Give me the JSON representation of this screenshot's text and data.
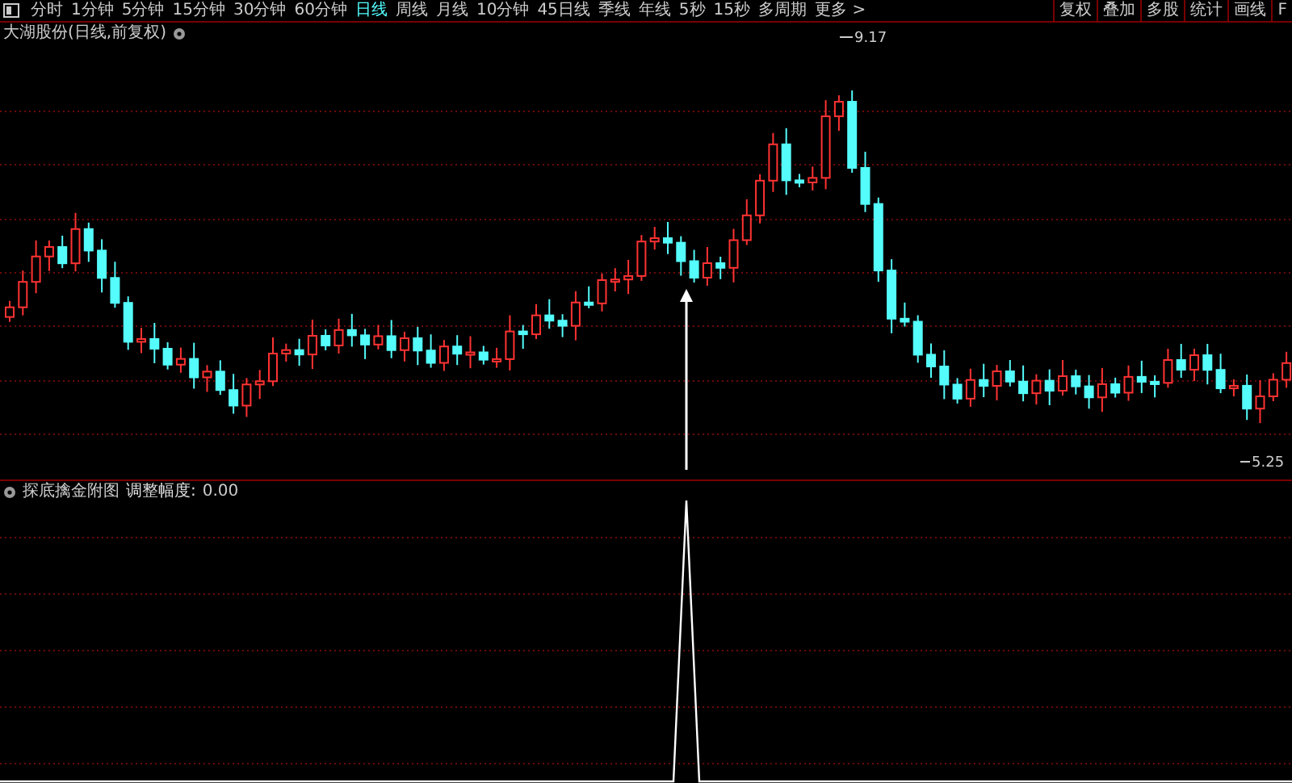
{
  "toolbar": {
    "periods": [
      {
        "label": "分时",
        "selected": false
      },
      {
        "label": "1分钟",
        "selected": false
      },
      {
        "label": "5分钟",
        "selected": false
      },
      {
        "label": "15分钟",
        "selected": false
      },
      {
        "label": "30分钟",
        "selected": false
      },
      {
        "label": "60分钟",
        "selected": false
      },
      {
        "label": "日线",
        "selected": true
      },
      {
        "label": "周线",
        "selected": false
      },
      {
        "label": "月线",
        "selected": false
      },
      {
        "label": "10分钟",
        "selected": false
      },
      {
        "label": "45日线",
        "selected": false
      },
      {
        "label": "季线",
        "selected": false
      },
      {
        "label": "年线",
        "selected": false
      },
      {
        "label": "5秒",
        "selected": false
      },
      {
        "label": "15秒",
        "selected": false
      },
      {
        "label": "多周期",
        "selected": false
      },
      {
        "label": "更多 >",
        "selected": false
      }
    ],
    "actions": [
      "复权",
      "叠加",
      "多股",
      "统计",
      "画线",
      "F"
    ]
  },
  "main_chart": {
    "title": "大湖股份(日线,前复权)",
    "high_label": "9.17",
    "low_label": "5.25"
  },
  "indicator": {
    "name": "探底擒金附图",
    "label": "调整幅度:",
    "value": "0.00"
  }
}
